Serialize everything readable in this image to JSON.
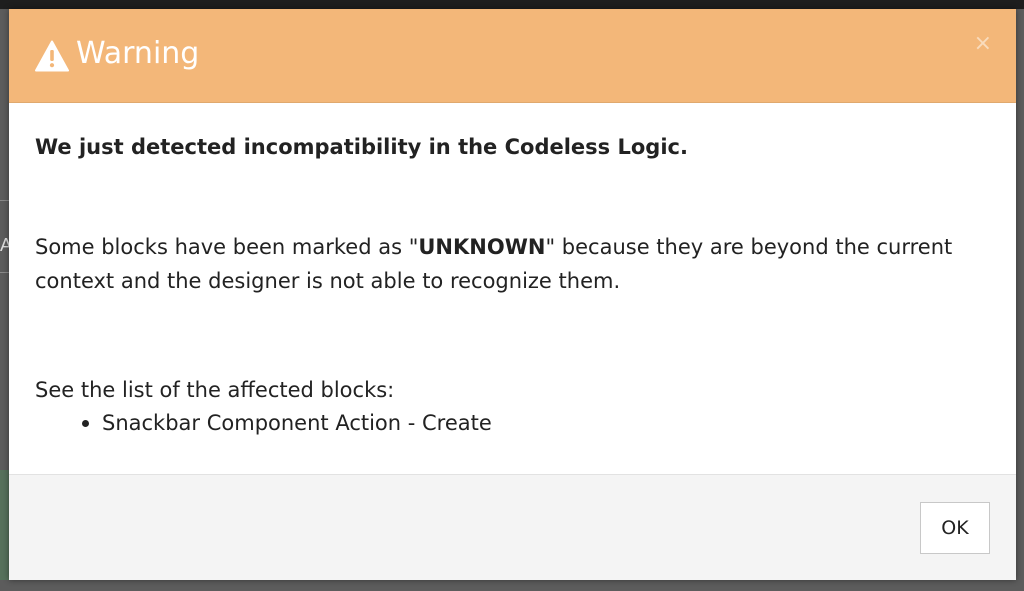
{
  "dialog": {
    "title": "Warning",
    "close_label": "×",
    "headline": "We just detected incompatibility in the Codeless Logic.",
    "message_before": "Some blocks have been marked as \"",
    "message_keyword": "UNKNOWN",
    "message_after": "\" because they are beyond the current context and the designer is not able to recognize them.",
    "list_intro": "See the list of the affected blocks:",
    "affected_blocks": [
      "Snackbar Component Action - Create"
    ],
    "ok_label": "OK"
  },
  "colors": {
    "header_background": "#f3b779",
    "header_text": "#ffffff",
    "body_text": "#222222",
    "footer_background": "#f4f4f4"
  },
  "icons": {
    "title_icon": "warning-triangle-icon",
    "close_icon": "close-icon"
  }
}
